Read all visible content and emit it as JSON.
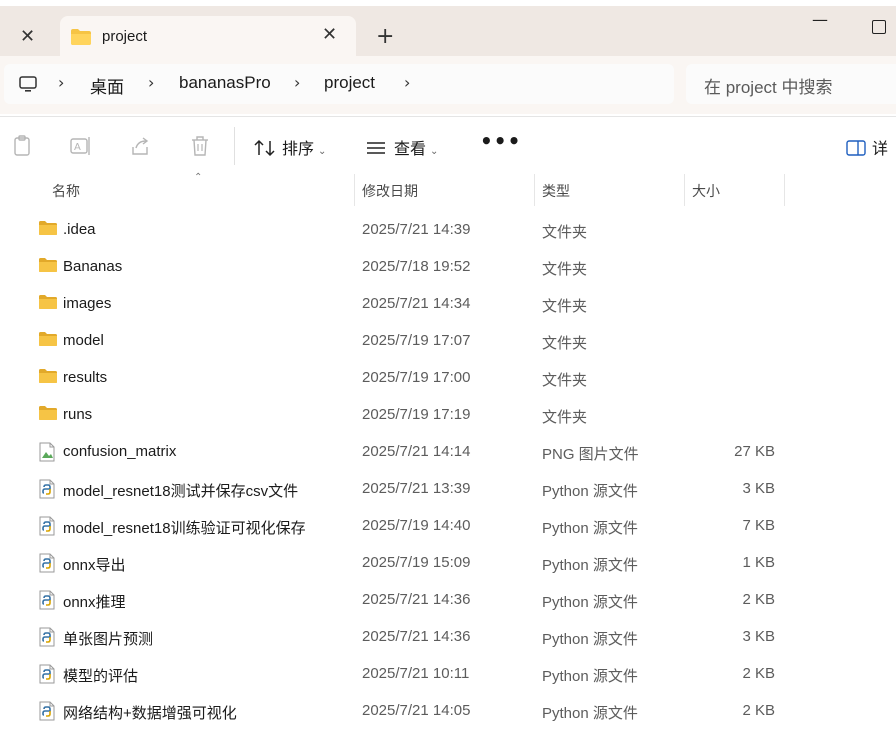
{
  "window": {
    "active_tab_title": "project",
    "new_tab_label": "+",
    "close_glyph": "✕",
    "minimize_glyph": "—"
  },
  "address": {
    "breadcrumbs": [
      "桌面",
      "bananasPro",
      "project"
    ],
    "search_placeholder": "在 project 中搜索"
  },
  "toolbar": {
    "sort_label": "排序",
    "view_label": "查看",
    "more_label": "•••",
    "details_label": "详"
  },
  "columns": {
    "name": "名称",
    "date": "修改日期",
    "type": "类型",
    "size": "大小"
  },
  "files": [
    {
      "name": ".idea",
      "date": "2025/7/21 14:39",
      "type": "文件夹",
      "size": "",
      "icon": "folder"
    },
    {
      "name": "Bananas",
      "date": "2025/7/18 19:52",
      "type": "文件夹",
      "size": "",
      "icon": "folder"
    },
    {
      "name": "images",
      "date": "2025/7/21 14:34",
      "type": "文件夹",
      "size": "",
      "icon": "folder"
    },
    {
      "name": "model",
      "date": "2025/7/19 17:07",
      "type": "文件夹",
      "size": "",
      "icon": "folder"
    },
    {
      "name": "results",
      "date": "2025/7/19 17:00",
      "type": "文件夹",
      "size": "",
      "icon": "folder"
    },
    {
      "name": "runs",
      "date": "2025/7/19 17:19",
      "type": "文件夹",
      "size": "",
      "icon": "folder"
    },
    {
      "name": "confusion_matrix",
      "date": "2025/7/21 14:14",
      "type": "PNG 图片文件",
      "size": "27 KB",
      "icon": "image"
    },
    {
      "name": "model_resnet18测试并保存csv文件",
      "date": "2025/7/21 13:39",
      "type": "Python 源文件",
      "size": "3 KB",
      "icon": "python"
    },
    {
      "name": "model_resnet18训练验证可视化保存",
      "date": "2025/7/19 14:40",
      "type": "Python 源文件",
      "size": "7 KB",
      "icon": "python"
    },
    {
      "name": "onnx导出",
      "date": "2025/7/19 15:09",
      "type": "Python 源文件",
      "size": "1 KB",
      "icon": "python"
    },
    {
      "name": "onnx推理",
      "date": "2025/7/21 14:36",
      "type": "Python 源文件",
      "size": "2 KB",
      "icon": "python"
    },
    {
      "name": "单张图片预测",
      "date": "2025/7/21 14:36",
      "type": "Python 源文件",
      "size": "3 KB",
      "icon": "python"
    },
    {
      "name": "模型的评估",
      "date": "2025/7/21 10:11",
      "type": "Python 源文件",
      "size": "2 KB",
      "icon": "python"
    },
    {
      "name": "网络结构+数据增强可视化",
      "date": "2025/7/21 14:05",
      "type": "Python 源文件",
      "size": "2 KB",
      "icon": "python"
    }
  ],
  "colors": {
    "folder": "#f6c445",
    "folder_dark": "#e2a92a",
    "python_blue": "#3572a5",
    "tab_bg": "#efe8e3"
  }
}
